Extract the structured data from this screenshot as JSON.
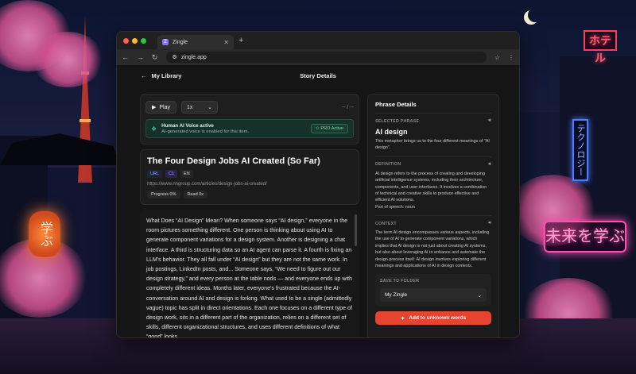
{
  "scene": {
    "sign_hotel": "ホテル",
    "sign_tech": "テクノロジー",
    "sign_learn": "未来を学ぶ",
    "lantern": "学ぶ"
  },
  "browser": {
    "tab_title": "Zingle",
    "tab_favicon": "zingle-favicon",
    "url": "zingle.app"
  },
  "header": {
    "back_label": "My Library",
    "title": "Story Details"
  },
  "player": {
    "play_label": "Play",
    "speed": "1x",
    "time": "-- / --",
    "voice_title": "Human AI Voice active",
    "voice_subtitle": "AI-generated voice is enabled for this item.",
    "pro_badge": "PRO Active"
  },
  "article": {
    "title": "The Four Design Jobs AI Created (So Far)",
    "tags": [
      "URL",
      "C1",
      "EN"
    ],
    "link": "https://www.nngroup.com/articles/design-jobs-ai-created/",
    "progress": "Progress 0%",
    "read": "Read 0x",
    "body": "What Does “AI Design” Mean? When someone says “AI design,” everyone in the room pictures something different. One person is thinking about using AI to generate component variations for a design system. Another is designing a chat interface. A third is structuring data so an AI agent can parse it. A fourth is fixing an LLM's behavior. They all fall under “AI design” but they are not the same work. In job postings, LinkedIn posts, and... Someone says, “We need to figure out our design strategy,” and every person at the table nods — and everyone ends up with completely different ideas. Months later, everyone's frustrated because the AI-conversation around AI and design is forking. What used to be a single (admittedly vague) topic has split in direct orientations. Each one focuses on a different type of design work, sits in a different part of the organization, relies on a different set of skills, different organizational structures, and uses different definitions of what “good” looks"
  },
  "panel": {
    "title": "Phrase Details",
    "selected_label": "SELECTED PHRASE",
    "phrase": "AI design",
    "phrase_sub": "This metaphor brings us to the four different meanings of \"AI design\".",
    "definition_label": "DEFINITION",
    "definition": "AI design refers to the process of creating and developing artificial intelligence systems, including their architecture, components, and user interfaces. It involves a combination of technical and creative skills to produce effective and efficient AI solutions.",
    "part_of_speech": "Part of speech: noun",
    "context_label": "CONTEXT",
    "context": "The term AI design encompasses various aspects, including the use of AI to generate component variations, which implies that AI design is not just about creating AI systems, but also about leveraging AI to enhance and automate the design process itself. AI design involves exploring different meanings and applications of AI in design contexts.",
    "save_label": "SAVE TO FOLDER",
    "folder": "My Zingle",
    "add_button": "Add to unknown words"
  }
}
